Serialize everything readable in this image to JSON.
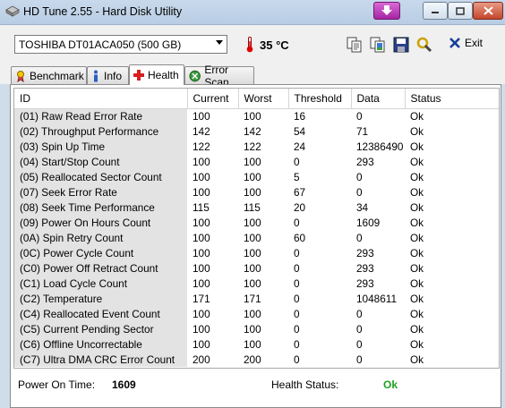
{
  "window": {
    "title": "HD Tune 2.55 - Hard Disk Utility"
  },
  "toolbar": {
    "drive": "TOSHIBA DT01ACA050 (500 GB)",
    "temperature": "35 °C",
    "exit_label": "Exit",
    "icons": [
      "copy-text-icon",
      "copy-screenshot-icon",
      "save-icon",
      "options-icon",
      "exit-icon"
    ]
  },
  "tabs": [
    {
      "label": "Benchmark",
      "icon": "benchmark-icon",
      "active": false
    },
    {
      "label": "Info",
      "icon": "info-icon",
      "active": false
    },
    {
      "label": "Health",
      "icon": "health-cross-icon",
      "active": true
    },
    {
      "label": "Error Scan",
      "icon": "error-scan-icon",
      "active": false
    }
  ],
  "table": {
    "columns": [
      "ID",
      "Current",
      "Worst",
      "Threshold",
      "Data",
      "Status"
    ],
    "rows": [
      [
        "(01) Raw Read Error Rate",
        "100",
        "100",
        "16",
        "0",
        "Ok"
      ],
      [
        "(02) Throughput Performance",
        "142",
        "142",
        "54",
        "71",
        "Ok"
      ],
      [
        "(03) Spin Up Time",
        "122",
        "122",
        "24",
        "12386490",
        "Ok"
      ],
      [
        "(04) Start/Stop Count",
        "100",
        "100",
        "0",
        "293",
        "Ok"
      ],
      [
        "(05) Reallocated Sector Count",
        "100",
        "100",
        "5",
        "0",
        "Ok"
      ],
      [
        "(07) Seek Error Rate",
        "100",
        "100",
        "67",
        "0",
        "Ok"
      ],
      [
        "(08) Seek Time Performance",
        "115",
        "115",
        "20",
        "34",
        "Ok"
      ],
      [
        "(09) Power On Hours Count",
        "100",
        "100",
        "0",
        "1609",
        "Ok"
      ],
      [
        "(0A) Spin Retry Count",
        "100",
        "100",
        "60",
        "0",
        "Ok"
      ],
      [
        "(0C) Power Cycle Count",
        "100",
        "100",
        "0",
        "293",
        "Ok"
      ],
      [
        "(C0) Power Off Retract Count",
        "100",
        "100",
        "0",
        "293",
        "Ok"
      ],
      [
        "(C1) Load Cycle Count",
        "100",
        "100",
        "0",
        "293",
        "Ok"
      ],
      [
        "(C2) Temperature",
        "171",
        "171",
        "0",
        "1048611",
        "Ok"
      ],
      [
        "(C4) Reallocated Event Count",
        "100",
        "100",
        "0",
        "0",
        "Ok"
      ],
      [
        "(C5) Current Pending Sector",
        "100",
        "100",
        "0",
        "0",
        "Ok"
      ],
      [
        "(C6) Offline Uncorrectable",
        "100",
        "100",
        "0",
        "0",
        "Ok"
      ],
      [
        "(C7) Ultra DMA CRC Error Count",
        "200",
        "200",
        "0",
        "0",
        "Ok"
      ]
    ]
  },
  "footer": {
    "power_on_time_label": "Power On Time:",
    "power_on_time_value": "1609",
    "health_status_label": "Health Status:",
    "health_status_value": "Ok"
  },
  "colors": {
    "status_ok": "#1fa21f",
    "id_column_bg": "#e3e3e3"
  }
}
